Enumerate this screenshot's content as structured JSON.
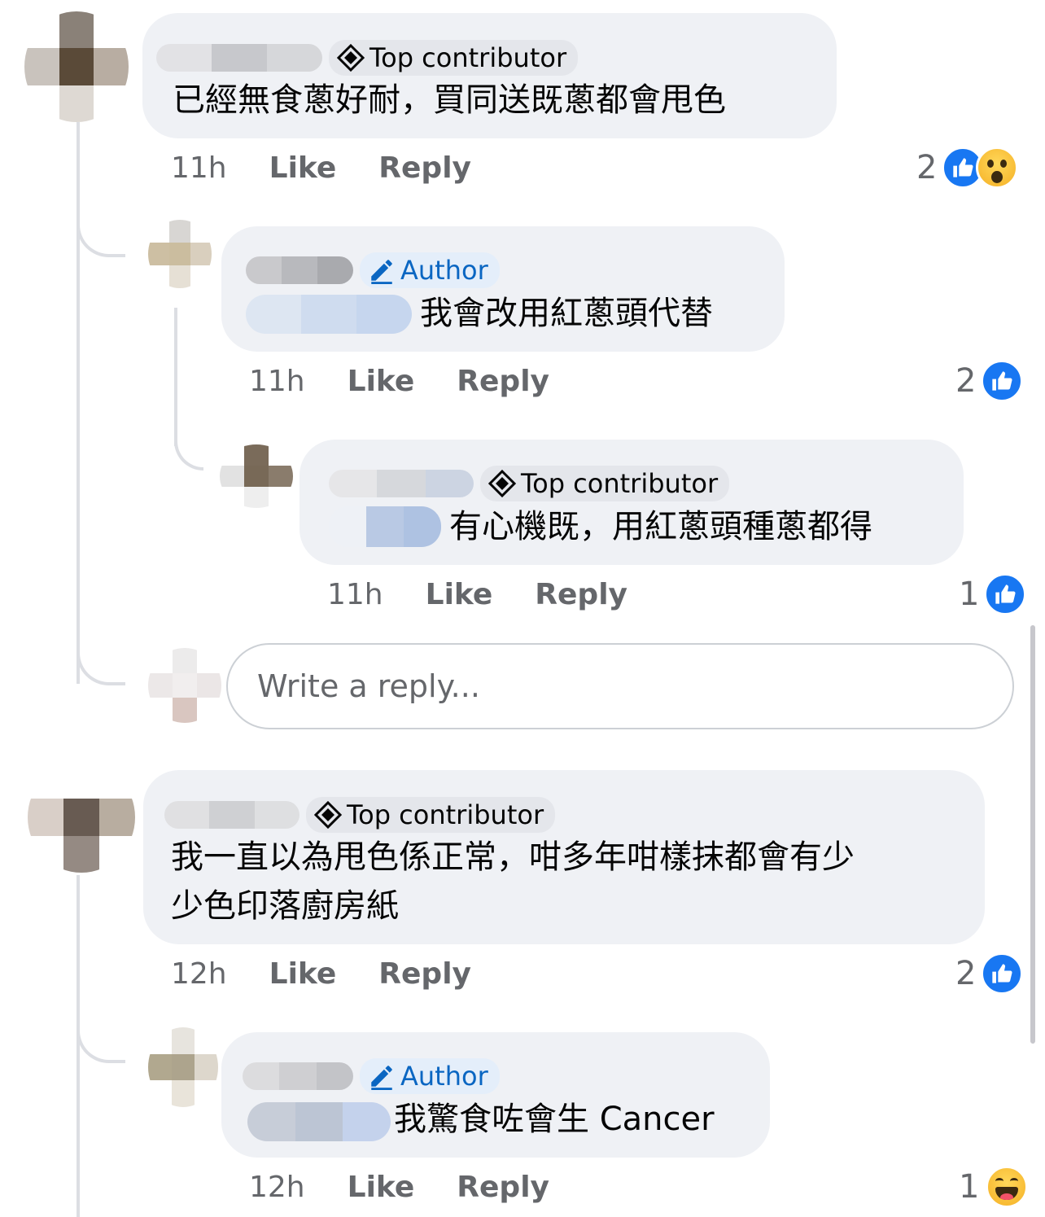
{
  "comments": [
    {
      "badge": "Top contributor",
      "text": "已經無食蔥好耐，買同送既蔥都會甩色",
      "time": "11h",
      "like": "Like",
      "reply": "Reply",
      "reaction_count": "2",
      "reactions": [
        "like-icon",
        "wow-icon"
      ]
    },
    {
      "badge": "Author",
      "text": "我會改用紅蔥頭代替",
      "time": "11h",
      "like": "Like",
      "reply": "Reply",
      "reaction_count": "2",
      "reactions": [
        "like-icon"
      ]
    },
    {
      "badge": "Top contributor",
      "text": "有心機既，用紅蔥頭種蔥都得",
      "time": "11h",
      "like": "Like",
      "reply": "Reply",
      "reaction_count": "1",
      "reactions": [
        "like-icon"
      ]
    },
    {
      "badge": "Top contributor",
      "text_line1": "我一直以為甩色係正常，咁多年咁樣抹都會有少",
      "text_line2": "少色印落廚房紙",
      "time": "12h",
      "like": "Like",
      "reply": "Reply",
      "reaction_count": "2",
      "reactions": [
        "like-icon"
      ]
    },
    {
      "badge": "Author",
      "text": "我驚食咗會生 Cancer",
      "time": "12h",
      "like": "Like",
      "reply": "Reply",
      "reaction_count": "1",
      "reactions": [
        "haha-icon"
      ]
    }
  ],
  "reply_input": {
    "placeholder": "Write a reply..."
  },
  "colors": {
    "like_blue": "#1877f2",
    "bubble": "#eff1f5",
    "author_blue": "#0a66c2",
    "meta_gray": "#65676b"
  }
}
